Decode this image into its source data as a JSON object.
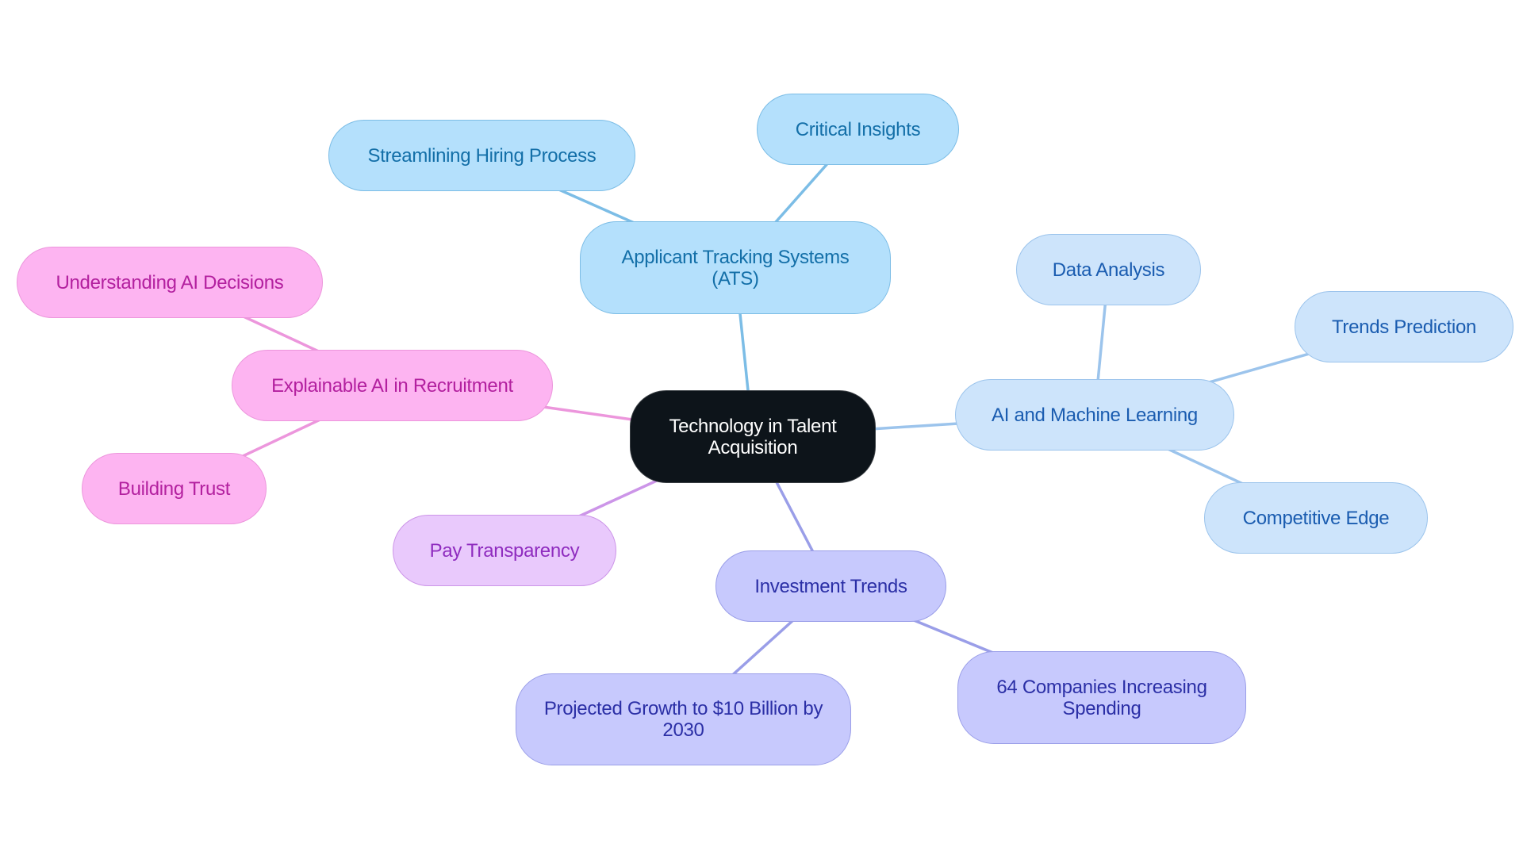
{
  "diagram": {
    "type": "mindmap",
    "root": {
      "id": "root",
      "label": "Technology in Talent Acquisition"
    },
    "branches": [
      {
        "id": "ats",
        "label": "Applicant Tracking Systems (ATS)",
        "color": "#7cbde6",
        "children": [
          {
            "id": "streamlining",
            "label": "Streamlining Hiring Process"
          },
          {
            "id": "critical",
            "label": "Critical Insights"
          }
        ]
      },
      {
        "id": "ml",
        "label": "AI and Machine Learning",
        "color": "#9cc4ec",
        "children": [
          {
            "id": "data",
            "label": "Data Analysis"
          },
          {
            "id": "trends",
            "label": "Trends Prediction"
          },
          {
            "id": "edge",
            "label": "Competitive Edge"
          }
        ]
      },
      {
        "id": "xai",
        "label": "Explainable AI in Recruitment",
        "color": "#ec96dc",
        "children": [
          {
            "id": "understanding",
            "label": "Understanding AI Decisions"
          },
          {
            "id": "trust",
            "label": "Building Trust"
          }
        ]
      },
      {
        "id": "pay",
        "label": "Pay Transparency",
        "color": "#cc95e8",
        "children": []
      },
      {
        "id": "inv",
        "label": "Investment Trends",
        "color": "#9a9ee8",
        "children": [
          {
            "id": "growth",
            "label": "Projected Growth to $10 Billion by 2030"
          },
          {
            "id": "companies",
            "label": "64 Companies Increasing Spending"
          }
        ]
      }
    ]
  },
  "nodes": {
    "root": "Technology in Talent Acquisition",
    "ats": "Applicant Tracking Systems (ATS)",
    "streamlining": "Streamlining Hiring Process",
    "critical": "Critical Insights",
    "ml": "AI and Machine Learning",
    "data": "Data Analysis",
    "trends": "Trends Prediction",
    "edge": "Competitive Edge",
    "xai": "Explainable AI in Recruitment",
    "understanding": "Understanding AI Decisions",
    "trust": "Building Trust",
    "pay": "Pay Transparency",
    "inv": "Investment Trends",
    "growth": "Projected Growth to $10 Billion by 2030",
    "companies": "64 Companies Increasing Spending"
  },
  "colors": {
    "root_fill": "#0d141a",
    "ats_fill": "#b4e0fc",
    "ml_fill": "#cde4fb",
    "xai_fill": "#fdb4f1",
    "pay_fill": "#e9c9fc",
    "inv_fill": "#c7c9fd"
  }
}
